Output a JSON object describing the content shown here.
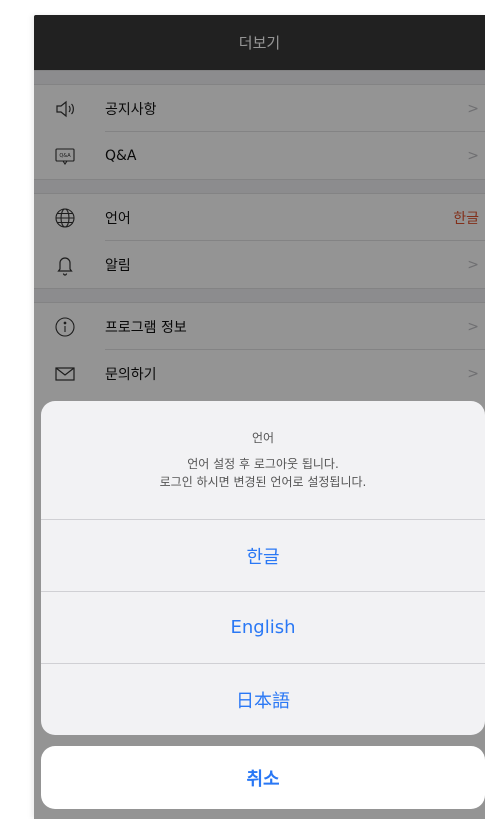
{
  "navbar": {
    "title": "더보기"
  },
  "menu": {
    "groups": [
      [
        {
          "label": "공지사항",
          "icon": "speaker-icon",
          "chevron": ">"
        },
        {
          "label": "Q&A",
          "icon": "qa-icon",
          "chevron": ">"
        }
      ],
      [
        {
          "label": "언어",
          "icon": "globe-icon",
          "value": "한글"
        },
        {
          "label": "알림",
          "icon": "bell-icon",
          "chevron": ">"
        }
      ],
      [
        {
          "label": "프로그램 정보",
          "icon": "info-icon",
          "chevron": ">"
        },
        {
          "label": "문의하기",
          "icon": "mail-icon",
          "chevron": ">"
        }
      ]
    ]
  },
  "action_sheet": {
    "title": "언어",
    "message_line1": "언어 설정 후 로그아웃 됩니다.",
    "message_line2": "로그인 하시면 변경된 언어로 설정됩니다.",
    "options": [
      "한글",
      "English",
      "日本語"
    ],
    "cancel": "취소"
  },
  "colors": {
    "navbar": "#3a3a3a",
    "accent_blue": "#2a78f5",
    "value_orange": "#e0522d"
  }
}
